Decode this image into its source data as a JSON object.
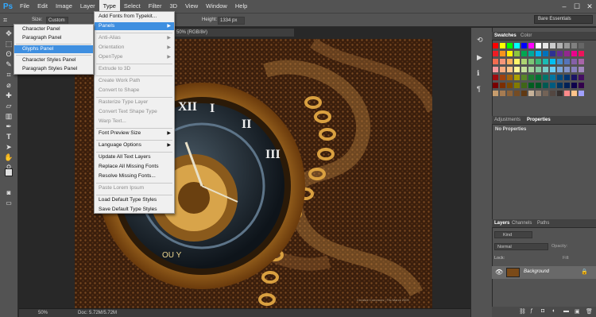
{
  "app": {
    "logo": "Ps"
  },
  "menubar": {
    "items": [
      "File",
      "Edit",
      "Image",
      "Layer",
      "Type",
      "Select",
      "Filter",
      "3D",
      "View",
      "Window",
      "Help"
    ],
    "active": "Type",
    "window_controls": [
      "–",
      "☐",
      "✕"
    ]
  },
  "options_bar": {
    "size_label": "Size:",
    "size_value": "Custom",
    "height_label": "Height:",
    "height_value": "1334 px",
    "workspace": "Bare Essentials"
  },
  "document": {
    "tab_title": "50% (RGB/8#)",
    "watermark": "Creative Commons | Flic.Marck 2009",
    "dial_numerals": [
      "XII",
      "I",
      "II",
      "III",
      "XI"
    ],
    "brand_text": "OU Y"
  },
  "status_bar": {
    "zoom": "50%",
    "doc_info": "Doc: 5.72M/5.72M"
  },
  "type_menu": {
    "items": [
      {
        "label": "Add Fonts from Typekit...",
        "enabled": true,
        "submenu": false
      },
      {
        "label": "Panels",
        "enabled": true,
        "submenu": true,
        "highlighted": true
      },
      {
        "label": "Anti-Alias",
        "enabled": false,
        "submenu": true
      },
      {
        "label": "Orientation",
        "enabled": false,
        "submenu": true
      },
      {
        "label": "OpenType",
        "enabled": false,
        "submenu": true
      },
      {
        "label": "Extrude to 3D",
        "enabled": false,
        "submenu": false
      },
      {
        "label": "Create Work Path",
        "enabled": false,
        "submenu": false
      },
      {
        "label": "Convert to Shape",
        "enabled": false,
        "submenu": false
      },
      {
        "label": "Rasterize Type Layer",
        "enabled": false,
        "submenu": false
      },
      {
        "label": "Convert Text Shape Type",
        "enabled": false,
        "submenu": false
      },
      {
        "label": "Warp Text...",
        "enabled": false,
        "submenu": false
      },
      {
        "label": "Font Preview Size",
        "enabled": true,
        "submenu": true
      },
      {
        "label": "Language Options",
        "enabled": true,
        "submenu": true
      },
      {
        "label": "Update All Text Layers",
        "enabled": true,
        "submenu": false
      },
      {
        "label": "Replace All Missing Fonts",
        "enabled": true,
        "submenu": false
      },
      {
        "label": "Resolve Missing Fonts...",
        "enabled": true,
        "submenu": false
      },
      {
        "label": "Paste Lorem Ipsum",
        "enabled": false,
        "submenu": false
      },
      {
        "label": "Load Default Type Styles",
        "enabled": true,
        "submenu": false
      },
      {
        "label": "Save Default Type Styles",
        "enabled": true,
        "submenu": false
      }
    ]
  },
  "panels_submenu": {
    "items": [
      {
        "label": "Character Panel",
        "highlighted": false
      },
      {
        "label": "Paragraph Panel",
        "highlighted": false
      },
      {
        "label": "Glyphs Panel",
        "highlighted": true
      },
      {
        "label": "Character Styles Panel",
        "highlighted": false
      },
      {
        "label": "Paragraph Styles Panel",
        "highlighted": false
      }
    ]
  },
  "swatches_panel": {
    "tabs": [
      "Swatches",
      "Color"
    ],
    "active_tab": "Swatches",
    "rows": [
      [
        "#ff0000",
        "#ffff00",
        "#00ff00",
        "#00ffff",
        "#0000ff",
        "#ff00ff",
        "#ffffff",
        "#e6e6e6",
        "#cccccc",
        "#b3b3b3",
        "#999999",
        "#808080",
        "#666666"
      ],
      [
        "#ed1c24",
        "#f7941d",
        "#fff200",
        "#8dc63f",
        "#00a651",
        "#00a99d",
        "#00aeef",
        "#0072bc",
        "#2e3192",
        "#662d91",
        "#92278f",
        "#ec008c",
        "#ed145b"
      ],
      [
        "#f26c4f",
        "#f69679",
        "#fbaf5d",
        "#fff568",
        "#acd372",
        "#7cc576",
        "#3bb878",
        "#1abbb4",
        "#00bff3",
        "#448ccb",
        "#5674b9",
        "#8560a8",
        "#a864a8"
      ],
      [
        "#f6989d",
        "#f9ad81",
        "#fdc68a",
        "#fff79a",
        "#c4df9b",
        "#a3d39c",
        "#82ca9d",
        "#7accc8",
        "#6dcff6",
        "#7da7d9",
        "#8393ca",
        "#8781bd",
        "#a187be"
      ],
      [
        "#9e0b0f",
        "#a0410d",
        "#a36209",
        "#aba000",
        "#598527",
        "#1a7b30",
        "#007236",
        "#00746b",
        "#0076a3",
        "#004a80",
        "#003471",
        "#1b1464",
        "#440e62"
      ],
      [
        "#790000",
        "#7b2e00",
        "#7d4900",
        "#827b00",
        "#406618",
        "#005e20",
        "#005826",
        "#005952",
        "#005b7f",
        "#003663",
        "#002157",
        "#0d004c",
        "#32004b"
      ],
      [
        "#c69c6d",
        "#a67c52",
        "#8c6239",
        "#754c24",
        "#603913",
        "#c7b299",
        "#998675",
        "#736357",
        "#534741",
        "#362f2d",
        "#ff8a8a",
        "#ffc48a",
        "#a0a0ff"
      ]
    ]
  },
  "properties_panel": {
    "tabs": [
      "Adjustments",
      "Properties"
    ],
    "active_tab": "Properties",
    "empty_text": "No Properties"
  },
  "layers_panel": {
    "tabs": [
      "Layers",
      "Channels",
      "Paths"
    ],
    "active_tab": "Layers",
    "filter_label": "Kind",
    "blend_mode": "Normal",
    "opacity_label": "Opacity:",
    "lock_label": "Lock:",
    "fill_label": "Fill:",
    "layer_name": "Background"
  }
}
